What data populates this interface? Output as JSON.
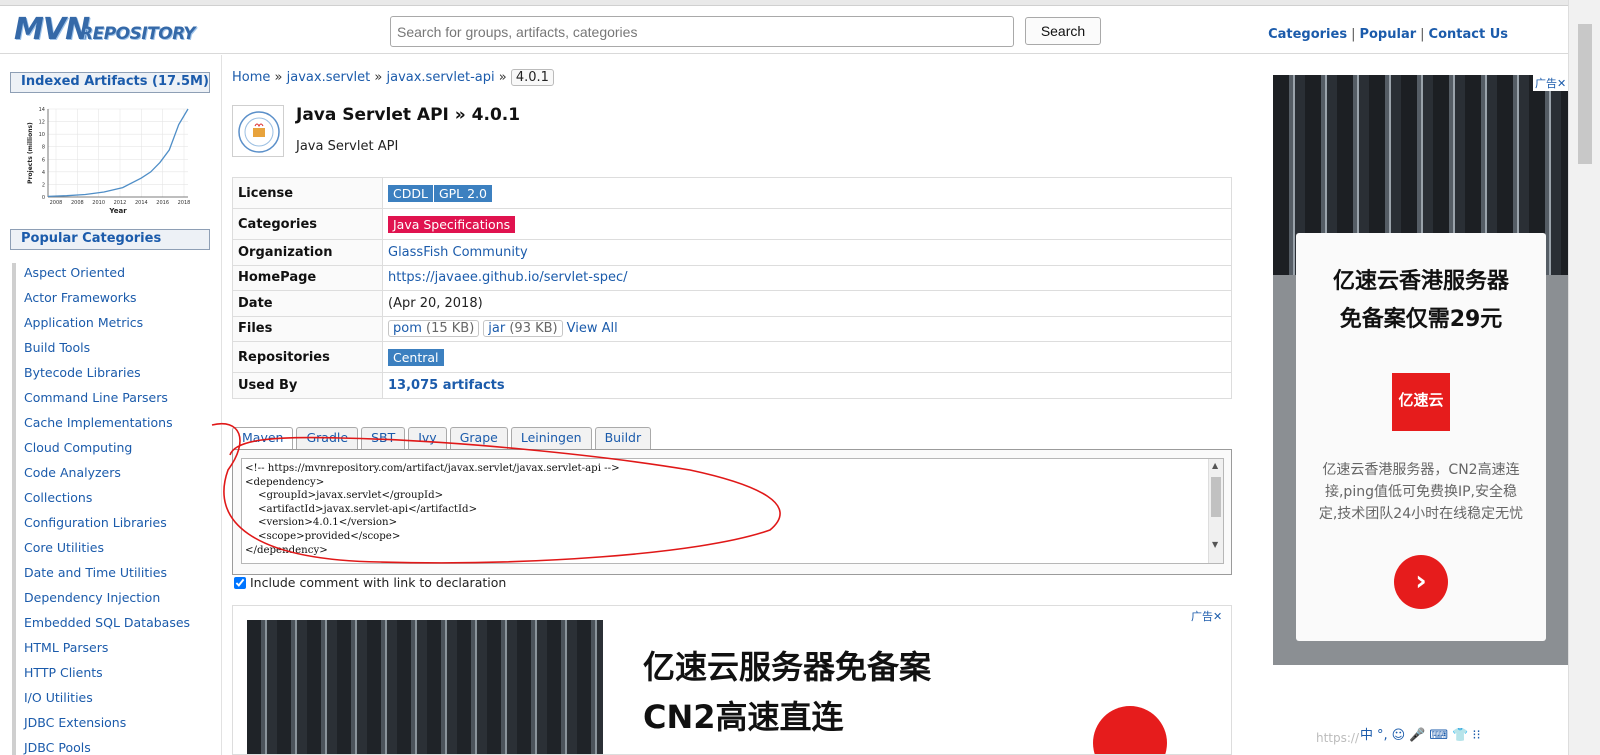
{
  "header": {
    "logo_main": "MVN",
    "logo_sub": "REPOSITORY",
    "search_placeholder": "Search for groups, artifacts, categories",
    "search_button": "Search",
    "nav": [
      "Categories",
      "Popular",
      "Contact Us"
    ],
    "nav_sep": "|"
  },
  "sidebar": {
    "indexed_title": "Indexed Artifacts (17.5M)",
    "popular_title": "Popular Categories",
    "categories": [
      "Aspect Oriented",
      "Actor Frameworks",
      "Application Metrics",
      "Build Tools",
      "Bytecode Libraries",
      "Command Line Parsers",
      "Cache Implementations",
      "Cloud Computing",
      "Code Analyzers",
      "Collections",
      "Configuration Libraries",
      "Core Utilities",
      "Date and Time Utilities",
      "Dependency Injection",
      "Embedded SQL Databases",
      "HTML Parsers",
      "HTTP Clients",
      "I/O Utilities",
      "JDBC Extensions",
      "JDBC Pools"
    ]
  },
  "chart_data": {
    "type": "line",
    "title": "",
    "xlabel": "Year",
    "ylabel": "Projects (millions)",
    "x": [
      2004,
      2006,
      2008,
      2010,
      2012,
      2014,
      2015,
      2016,
      2017,
      2018,
      2019
    ],
    "y": [
      0.1,
      0.2,
      0.4,
      0.8,
      1.5,
      3.0,
      4.0,
      5.5,
      7.5,
      11.5,
      14.0
    ],
    "xticks": [
      "2008",
      "2008",
      "2010",
      "2012",
      "2014",
      "2016",
      "2018"
    ],
    "yticks": [
      "0",
      "2",
      "4",
      "6",
      "8",
      "10",
      "12",
      "14"
    ],
    "xlim": [
      2004,
      2019
    ],
    "ylim": [
      0,
      14
    ],
    "grid": true,
    "color": "#4f8ec7"
  },
  "breadcrumb": {
    "home": "Home",
    "group": "javax.servlet",
    "artifact": "javax.servlet-api",
    "version": "4.0.1",
    "sep": "»"
  },
  "artifact": {
    "title": "Java Servlet API » 4.0.1",
    "subtitle": "Java Servlet API"
  },
  "info": {
    "license_key": "License",
    "licenses": [
      "CDDL",
      "GPL 2.0"
    ],
    "categories_key": "Categories",
    "category": "Java Specifications",
    "organization_key": "Organization",
    "organization": "GlassFish Community",
    "homepage_key": "HomePage",
    "homepage": "https://javaee.github.io/servlet-spec/",
    "date_key": "Date",
    "date": "(Apr 20, 2018)",
    "files_key": "Files",
    "file_pom": "pom",
    "file_pom_size": "(15 KB)",
    "file_jar": "jar",
    "file_jar_size": "(93 KB)",
    "view_all": "View All",
    "repositories_key": "Repositories",
    "repository": "Central",
    "used_by_key": "Used By",
    "used_by": "13,075 artifacts"
  },
  "tabs": [
    "Maven",
    "Gradle",
    "SBT",
    "Ivy",
    "Grape",
    "Leiningen",
    "Buildr"
  ],
  "code": "<!-- https://mvnrepository.com/artifact/javax.servlet/javax.servlet-api -->\n<dependency>\n    <groupId>javax.servlet</groupId>\n    <artifactId>javax.servlet-api</artifactId>\n    <version>4.0.1</version>\n    <scope>provided</scope>\n</dependency>",
  "include_label": "Include comment with link to declaration",
  "ads": {
    "tag": "广告✕",
    "bottom_line1": "亿速云服务器免备案",
    "bottom_line2": "CN2高速直连",
    "right_line1": "亿速云香港服务器",
    "right_line2": "免备案仅需29元",
    "right_brand": "亿速云",
    "right_desc": "亿速云香港服务器，CN2高速连接,ping值低可免费换IP,安全稳定,技术团队24小时在线稳定无忧",
    "right_go": "›"
  },
  "watermark": "https://",
  "ime": [
    "中",
    "°,",
    "☺",
    "🎤",
    "⌨",
    "👕",
    "⁝⁝"
  ]
}
